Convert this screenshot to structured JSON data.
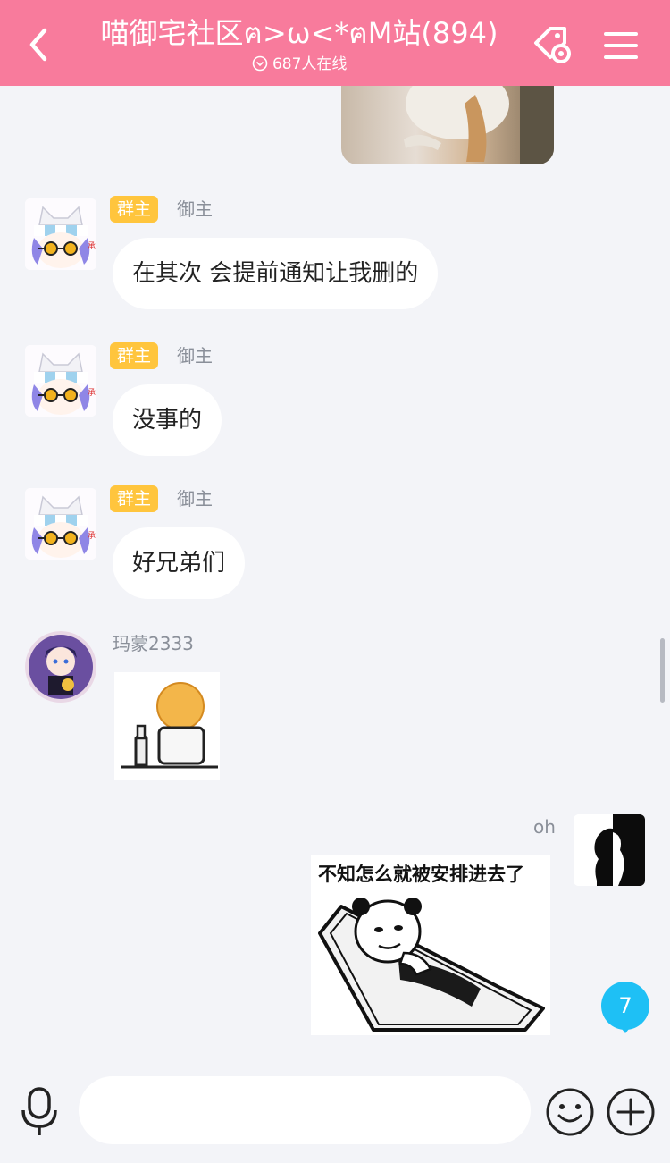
{
  "header": {
    "back_icon": "chevron-left-icon",
    "title": "喵御宅社区ฅ>ω<*ฅM站(894)",
    "online_count": "687人在线",
    "settings_icon": "tag-settings-icon",
    "menu_icon": "hamburger-menu-icon",
    "background_color": "#f87b9c"
  },
  "messages": [
    {
      "badge": "群主",
      "sender": "御主",
      "text": "在其次  会提前通知让我删的"
    },
    {
      "badge": "群主",
      "sender": "御主",
      "text": "没事的"
    },
    {
      "badge": "群主",
      "sender": "御主",
      "text": "好兄弟们"
    },
    {
      "sender": "玛蒙2333",
      "sticker": "bald-head-doll-sticker"
    },
    {
      "sender": "oh",
      "sticker_caption": "不知怎么就被安排进去了",
      "sticker": "panda-in-coffin-sticker"
    }
  ],
  "unread_badge": "7",
  "input": {
    "placeholder": ""
  },
  "bottom_bar": {
    "voice_icon": "microphone-icon",
    "emoji_icon": "smiley-icon",
    "more_icon": "plus-circle-icon"
  },
  "colors": {
    "badge": "#ffc53d",
    "unread": "#1ec0f5",
    "chat_bg": "#f3f4f8"
  }
}
